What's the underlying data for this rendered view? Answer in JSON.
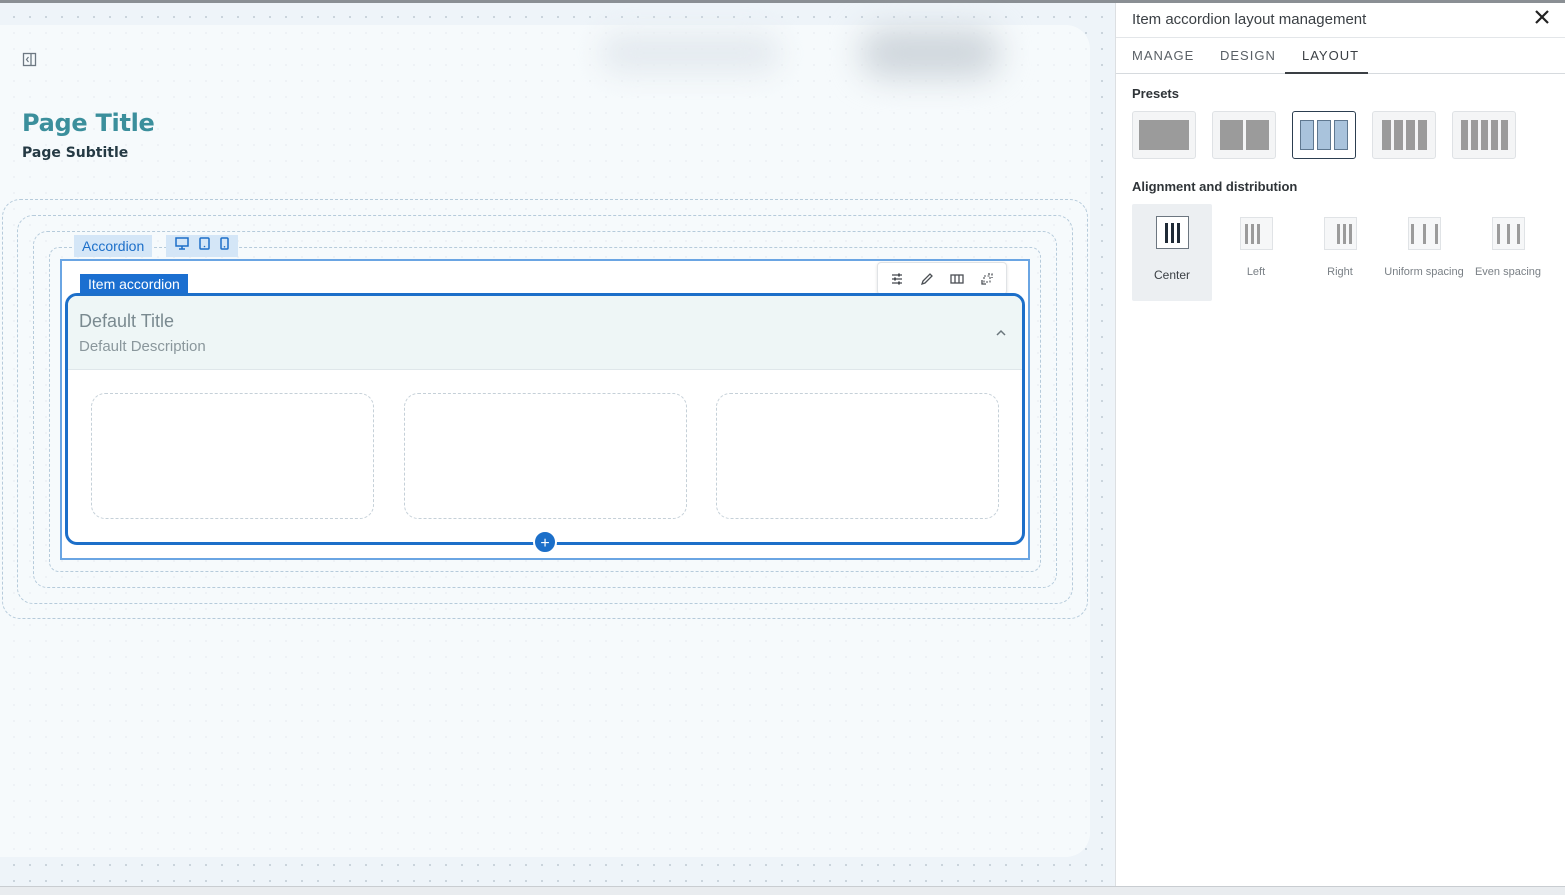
{
  "canvas": {
    "page_title": "Page Title",
    "page_subtitle": "Page Subtitle",
    "accordion_label": "Accordion",
    "item_label": "Item accordion",
    "panel": {
      "title": "Default Title",
      "description": "Default Description"
    },
    "add_symbol": "+",
    "icons": [
      "collapse-sidebar-icon",
      "desktop-icon",
      "tablet-icon",
      "mobile-icon",
      "settings-sliders-icon",
      "edit-pencil-icon",
      "columns-icon",
      "move-icon",
      "chevron-up-icon"
    ]
  },
  "panel": {
    "title": "Item accordion layout management",
    "close_icon": "close-icon",
    "tabs": [
      {
        "label": "MANAGE",
        "active": false
      },
      {
        "label": "DESIGN",
        "active": false
      },
      {
        "label": "LAYOUT",
        "active": true
      }
    ],
    "presets_label": "Presets",
    "presets": [
      {
        "columns": 1,
        "selected": false
      },
      {
        "columns": 2,
        "selected": false
      },
      {
        "columns": 3,
        "selected": true
      },
      {
        "columns": 4,
        "selected": false
      },
      {
        "columns": 5,
        "selected": false
      }
    ],
    "alignment_label": "Alignment and distribution",
    "alignment_options": [
      {
        "label": "Center",
        "selected": true
      },
      {
        "label": "Left",
        "selected": false
      },
      {
        "label": "Right",
        "selected": false
      },
      {
        "label": "Uniform spacing",
        "selected": false
      },
      {
        "label": "Even spacing",
        "selected": false
      }
    ]
  },
  "colors": {
    "accent": "#1c6fc9",
    "title_teal": "#3b8f9c",
    "canvas_bg": "#eef4f9"
  }
}
